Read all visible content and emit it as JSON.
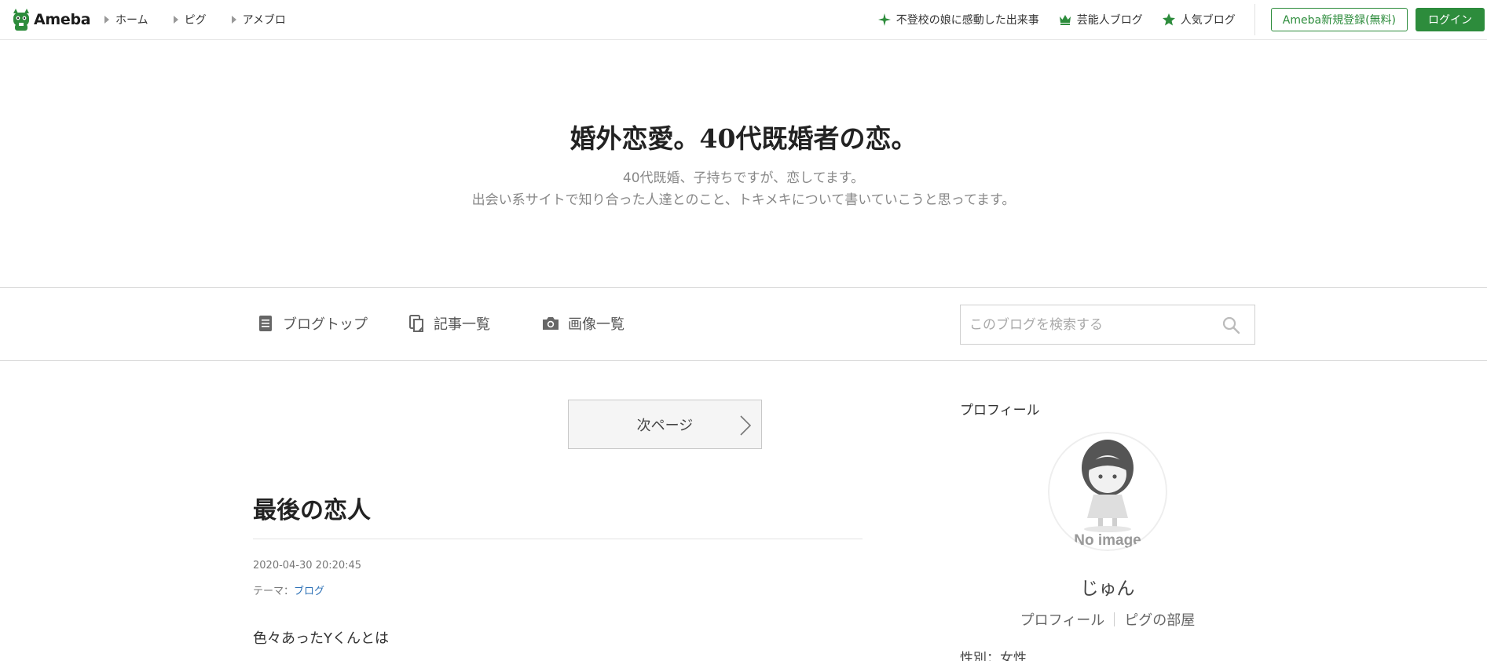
{
  "header": {
    "logo_text": "Ameba",
    "nav": [
      "ホーム",
      "ピグ",
      "アメブロ"
    ],
    "right_links": [
      {
        "label": "不登校の娘に感動した出来事",
        "icon": "sparkle-icon"
      },
      {
        "label": "芸能人ブログ",
        "icon": "crown-icon"
      },
      {
        "label": "人気ブログ",
        "icon": "star-icon"
      }
    ],
    "register_label": "Ameba新規登録(無料)",
    "login_label": "ログイン",
    "accent_color": "#2d8c3c"
  },
  "blog": {
    "title": "婚外恋愛。40代既婚者の恋。",
    "description_line1": "40代既婚、子持ちですが、恋してます。",
    "description_line2": "出会い系サイトで知り合った人達とのこと、トキメキについて書いていこうと思ってます。"
  },
  "blog_nav": {
    "items": [
      {
        "label": "ブログトップ",
        "icon": "document-icon"
      },
      {
        "label": "記事一覧",
        "icon": "copy-icon"
      },
      {
        "label": "画像一覧",
        "icon": "camera-icon"
      }
    ],
    "search_placeholder": "このブログを検索する"
  },
  "main": {
    "next_page_label": "次ページ",
    "post": {
      "title": "最後の恋人",
      "datetime": "2020-04-30 20:20:45",
      "theme_label": "テーマ：",
      "theme_value": "ブログ",
      "body_line1": "色々あったYくんとは"
    }
  },
  "sidebar": {
    "heading": "プロフィール",
    "avatar_label": "No image",
    "name": "じゅん",
    "links": [
      "プロフィール",
      "ピグの部屋"
    ],
    "gender": "性別：女性"
  }
}
